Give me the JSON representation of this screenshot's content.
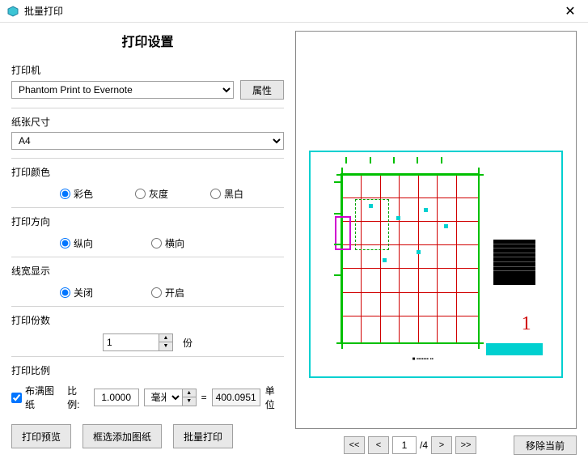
{
  "window": {
    "title": "批量打印"
  },
  "panel": {
    "title": "打印设置"
  },
  "printer": {
    "label": "打印机",
    "selected": "Phantom Print to Evernote",
    "props_button": "属性"
  },
  "paper": {
    "label": "纸张尺寸",
    "selected": "A4"
  },
  "color": {
    "label": "打印颜色",
    "options": {
      "color": "彩色",
      "gray": "灰度",
      "bw": "黑白"
    }
  },
  "orientation": {
    "label": "打印方向",
    "options": {
      "portrait": "纵向",
      "landscape": "横向"
    }
  },
  "linewidth": {
    "label": "线宽显示",
    "options": {
      "off": "关闭",
      "on": "开启"
    }
  },
  "copies": {
    "label": "打印份数",
    "value": "1",
    "unit": "份"
  },
  "ratio": {
    "label": "打印比例",
    "fill_checkbox": "布满图纸",
    "ratio_label": "比例:",
    "ratio_value": "1.0000",
    "unit_selected": "毫米",
    "equals": "=",
    "result": "400.0951",
    "result_unit": "单位"
  },
  "buttons": {
    "preview": "打印预览",
    "frame_add": "框选添加图纸",
    "batch_print": "批量打印",
    "remove_current": "移除当前"
  },
  "nav": {
    "first": "<<",
    "prev": "<",
    "current": "1",
    "total": "/4",
    "next": ">",
    "last": ">>"
  }
}
